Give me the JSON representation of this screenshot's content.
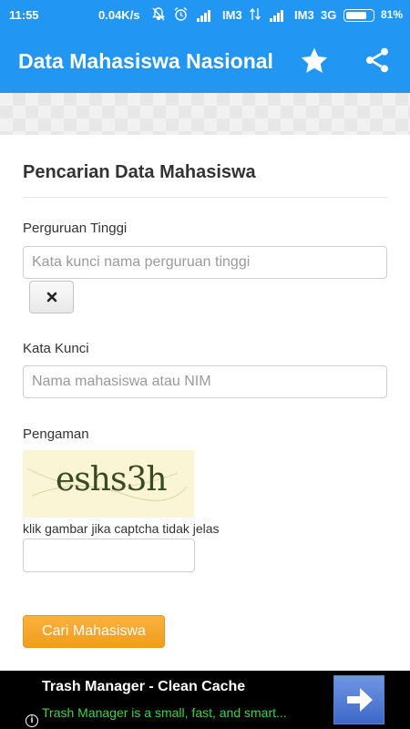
{
  "status_bar": {
    "time": "11:55",
    "speed": "0.04K/s",
    "carrier1": "IM3",
    "carrier2": "IM3",
    "network": "3G",
    "battery_text": "81%",
    "battery_level": 0.81,
    "icons": [
      "mute-icon",
      "alarm-icon",
      "signal-icon",
      "data-activity-icon",
      "battery-icon"
    ]
  },
  "app_bar": {
    "title": "Data Mahasiswa Nasional",
    "icons": [
      "star-icon",
      "share-icon"
    ],
    "color": "#2196f3"
  },
  "form": {
    "heading": "Pencarian Data Mahasiswa",
    "perguruan_label": "Perguruan Tinggi",
    "perguruan_placeholder": "Kata kunci nama perguruan tinggi",
    "clear_icon": "close-icon",
    "kata_kunci_label": "Kata Kunci",
    "kata_kunci_placeholder": "Nama mahasiswa atau NIM",
    "pengaman_label": "Pengaman",
    "captcha_text": "eshs3h",
    "captcha_hint": "klik gambar jika captcha tidak jelas",
    "captcha_value": "",
    "submit_label": "Cari Mahasiswa",
    "submit_color": "#f7a42c"
  },
  "ad": {
    "title": "Trash Manager - Clean Cache",
    "description": "Trash Manager is a small, fast, and smart...",
    "description_color": "#3fd24a",
    "icons": [
      "info-icon",
      "arrow-right-icon"
    ]
  }
}
